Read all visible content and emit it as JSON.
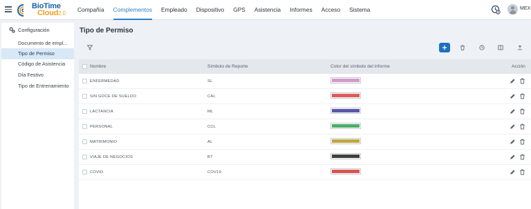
{
  "brand": {
    "line1": "BioTime",
    "line2": "Cloud",
    "version": "2.0"
  },
  "nav": [
    "Compañía",
    "Complementos",
    "Empleado",
    "Dispositivo",
    "GPS",
    "Asistencia",
    "Informes",
    "Acceso",
    "Sistema"
  ],
  "nav_active_index": 1,
  "user": {
    "name": "MEX"
  },
  "sidebar": {
    "header": "Configuración",
    "items": [
      {
        "label": "Documento de empl..."
      },
      {
        "label": "Tipo de Permiso"
      },
      {
        "label": "Código de Asistencia"
      },
      {
        "label": "Día Festivo"
      },
      {
        "label": "Tipo de Entrenamiento"
      }
    ],
    "active_index": 1
  },
  "page": {
    "title": "Tipo de Permiso"
  },
  "icons": {
    "filter": "filter-icon",
    "add": "plus-icon",
    "delete": "trash-icon",
    "history": "clock-icon",
    "columns": "columns-icon",
    "export": "upload-icon",
    "edit": "pencil-icon"
  },
  "colors": {
    "accent": "#2a7fc8",
    "primary_button": "#1f6fbf"
  },
  "table": {
    "headers": {
      "name": "Nombre",
      "symbol": "Símbolo de Reporte",
      "color": "Color del símbolo del informe",
      "action": "Acción"
    },
    "rows": [
      {
        "name": "ENFERMEDAD",
        "symbol": "SL",
        "color": "#d49ac8"
      },
      {
        "name": "SIN GOCE DE SUELDO",
        "symbol": "CAL",
        "color": "#e05a5a"
      },
      {
        "name": "LACTANCIA",
        "symbol": "ML",
        "color": "#5b57a6"
      },
      {
        "name": "PERSONAL",
        "symbol": "CCL",
        "color": "#4cae6a"
      },
      {
        "name": "MATRIMONIO",
        "symbol": "AL",
        "color": "#c0a83e"
      },
      {
        "name": "VIAJE DE NEGOCIOS",
        "symbol": "BT",
        "color": "#404040"
      },
      {
        "name": "COVID",
        "symbol": "COV19",
        "color": "#d9534f"
      }
    ]
  }
}
